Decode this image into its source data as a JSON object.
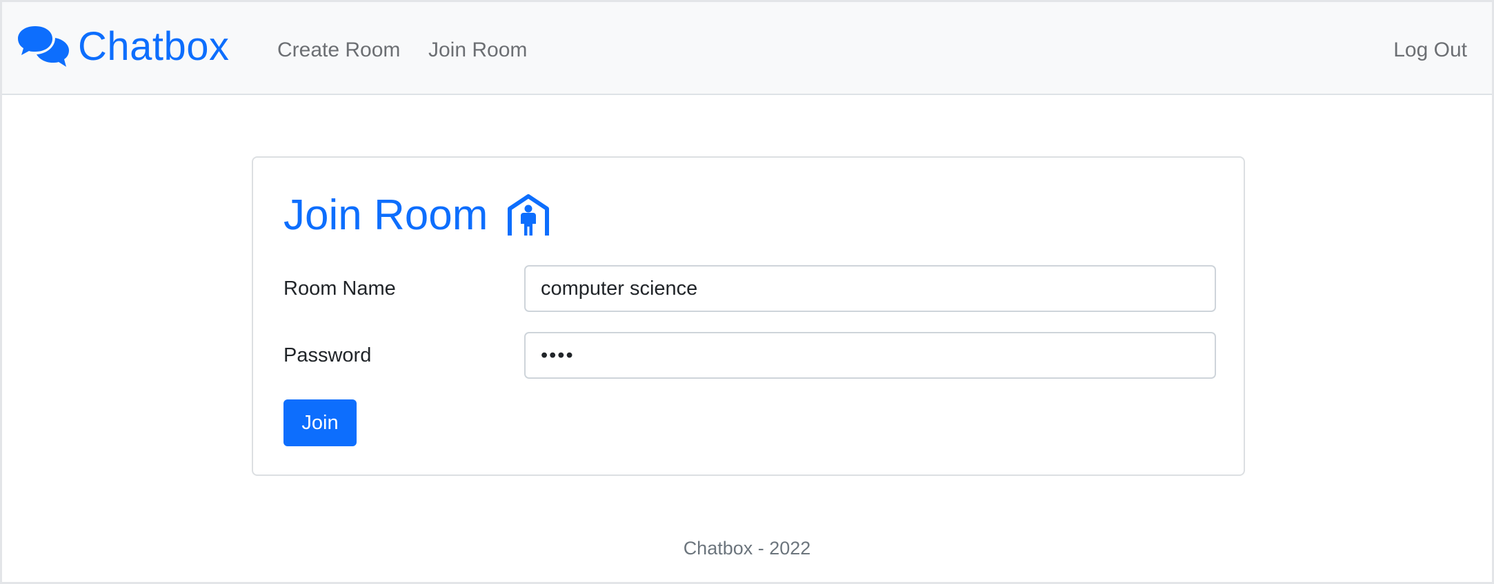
{
  "navbar": {
    "brand": "Chatbox",
    "brand_icon": "chat-bubbles-icon",
    "links": {
      "create_room": "Create Room",
      "join_room": "Join Room",
      "log_out": "Log Out"
    }
  },
  "card": {
    "title": "Join Room",
    "title_icon": "person-in-house-icon",
    "fields": {
      "room_name": {
        "label": "Room Name",
        "value": "computer science"
      },
      "password": {
        "label": "Password",
        "value": "abcd"
      }
    },
    "join_button": "Join"
  },
  "footer": {
    "text": "Chatbox - 2022"
  },
  "colors": {
    "accent": "#0d6efd",
    "navbar_bg": "#f8f9fa",
    "muted_text": "#6c757d"
  }
}
